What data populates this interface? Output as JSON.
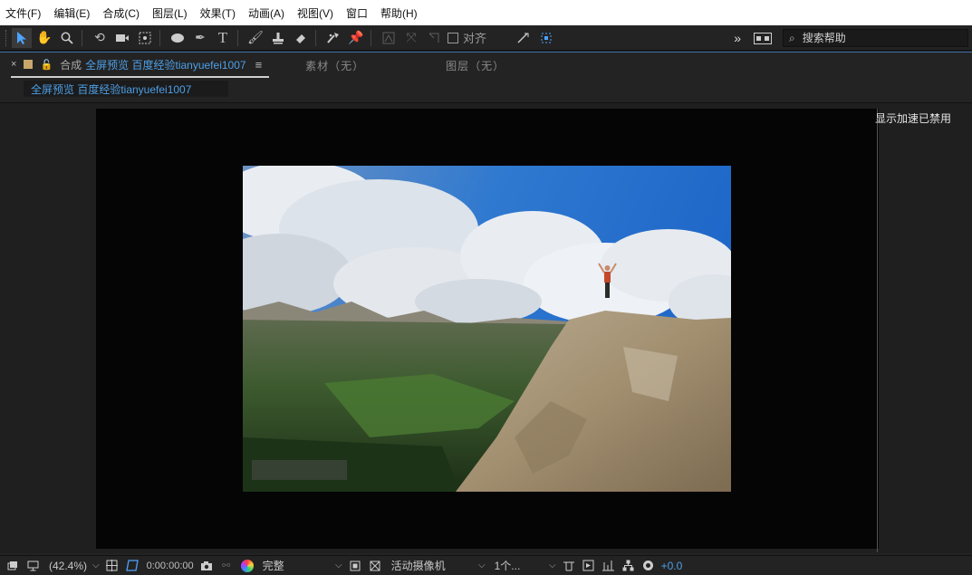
{
  "menu": [
    "文件(F)",
    "编辑(E)",
    "合成(C)",
    "图层(L)",
    "效果(T)",
    "动画(A)",
    "视图(V)",
    "窗口",
    "帮助(H)"
  ],
  "toolbar": {
    "snap_label": "对齐",
    "more": "»",
    "search_placeholder": "搜索帮助"
  },
  "panel": {
    "close": "×",
    "comp_label": "合成",
    "comp_name": "全屏预览 百度经验tianyuefei1007",
    "menu_icon": "≡",
    "footage_tab": "素材（无）",
    "layer_tab": "图层（无）",
    "subtab": "全屏预览 百度经验tianyuefei1007"
  },
  "viewer": {
    "accel_text": "显示加速已禁用"
  },
  "bottombar": {
    "zoom": "(42.4%)",
    "timecode": "0:00:00:00",
    "resolution": "完整",
    "camera": "活动摄像机",
    "views": "1个...",
    "exposure": "+0.0"
  },
  "colors": {
    "accent_blue": "#4d9fe6",
    "panel_bg": "#232323",
    "menubar_bg": "#ffffff"
  }
}
